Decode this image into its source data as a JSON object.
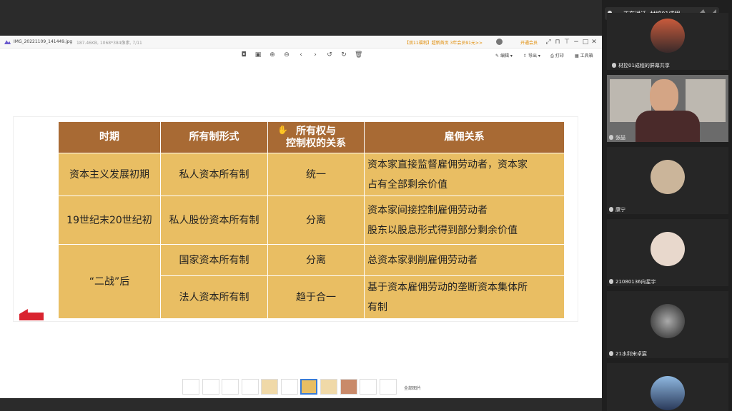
{
  "meeting": {
    "speaking_label": "正在讲话: 材控01成程;"
  },
  "viewer": {
    "filename": "IMG_20221109_141449.jpg",
    "fileinfo": "187.46KB, 1068*384像素, 7/11",
    "promo": "【双11福利】超新首页 3年会员91元>>",
    "open_member": "开通会员",
    "edit_label": "编辑",
    "export_label": "导出",
    "print_label": "打印",
    "toolbox_label": "工具箱",
    "all_images_label": "全部图片"
  },
  "table": {
    "headers": [
      "时期",
      "所有制形式",
      "所有权与控制权的关系",
      "雇佣关系"
    ],
    "header_lines": [
      [
        "时期"
      ],
      [
        "所有制形式"
      ],
      [
        "所有权与",
        "控制权的关系"
      ],
      [
        "雇佣关系"
      ]
    ],
    "rows": [
      {
        "period": "资本主义发展初期",
        "form": "私人资本所有制",
        "relation": "统一",
        "employment": [
          "直接",
          "资本家直接监督雇佣劳动者，资本家",
          "占有全部剩余价值"
        ]
      },
      {
        "period": "19世纪末20世纪初",
        "form": "私人股份资本所有制",
        "relation": "分离",
        "employment": [
          "资本家间接控制雇佣劳动者",
          "股东以股息形式得到部分剩余价值"
        ]
      },
      {
        "period": "“二战”后",
        "form": "国家资本所有制",
        "relation": "分离",
        "employment": [
          "总资本家剥削雇佣劳动者"
        ]
      },
      {
        "period": "",
        "form": "法人资本所有制",
        "relation": "趋于合一",
        "employment": [
          "基于资本雇佣劳动的垄断资本集体所",
          "有制"
        ]
      }
    ]
  },
  "participants": [
    {
      "name": "材控01成程的屏幕共享"
    },
    {
      "name": "张喆"
    },
    {
      "name": "康宁"
    },
    {
      "name": "21080136向星宇"
    },
    {
      "name": "21水利宋卓宸"
    },
    {
      "name": ""
    }
  ]
}
